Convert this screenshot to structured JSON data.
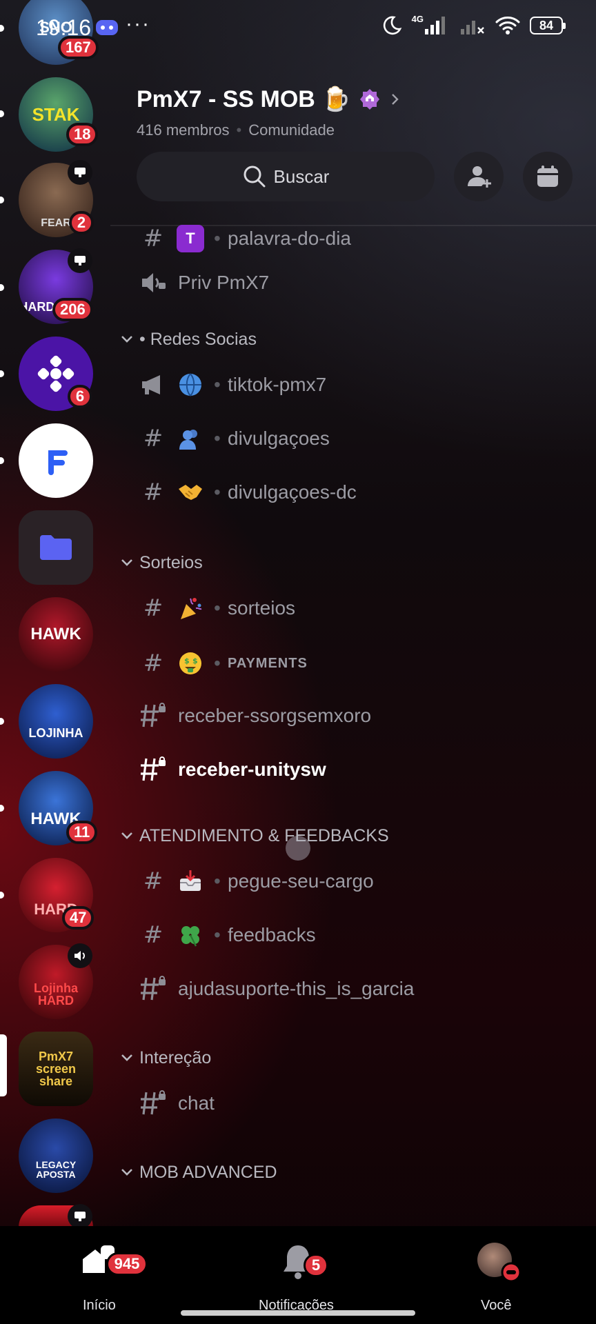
{
  "status_bar": {
    "time": "19:16",
    "network": "4G",
    "battery": "84"
  },
  "server": {
    "name": "PmX7 - SS MOB 🍺",
    "members": "416 membros",
    "type": "Comunidade",
    "search_label": "Buscar"
  },
  "rail": {
    "servers": [
      {
        "name": "server-1",
        "text": "SNO",
        "badge": "167"
      },
      {
        "name": "server-stake",
        "text": "STAK",
        "badge": "18"
      },
      {
        "name": "server-apes",
        "text": "FEAR",
        "badge": "2"
      },
      {
        "name": "server-hard-apostas",
        "text": "HARD APOS",
        "badge": "206"
      },
      {
        "name": "server-purple",
        "text": "",
        "badge": "6"
      },
      {
        "name": "server-f",
        "text": "",
        "badge": ""
      },
      {
        "name": "server-hawk",
        "text": "HAWK",
        "badge": ""
      },
      {
        "name": "server-lojinha-hawk",
        "text": "LOJINHA",
        "badge": ""
      },
      {
        "name": "server-hawk-esports",
        "text": "HAWK",
        "badge": "11"
      },
      {
        "name": "server-hard-apostas-2",
        "text": "HARD",
        "badge": "47"
      },
      {
        "name": "server-lojinha-hard",
        "text": "Lojinha HARD",
        "badge": ""
      },
      {
        "name": "server-pmx7",
        "text": "PmX7 screen share",
        "badge": ""
      },
      {
        "name": "server-legacy",
        "text": "LEGACY APOSTA",
        "badge": ""
      }
    ]
  },
  "channels": {
    "items": [
      {
        "kind": "channel",
        "label": "palavra-do-dia"
      },
      {
        "kind": "voice",
        "label": "Priv PmX7"
      },
      {
        "kind": "category",
        "label": "• Redes Socias"
      },
      {
        "kind": "announce",
        "label": "tiktok-pmx7"
      },
      {
        "kind": "channel",
        "label": "divulgaçoes"
      },
      {
        "kind": "channel",
        "label": "divulgaçoes-dc"
      },
      {
        "kind": "category",
        "label": "Sorteios"
      },
      {
        "kind": "channel",
        "label": "sorteios"
      },
      {
        "kind": "channel",
        "label": "PAYMENTS"
      },
      {
        "kind": "locked",
        "label": "receber-ssorgsemxoro"
      },
      {
        "kind": "locked",
        "label": "receber-unitysw"
      },
      {
        "kind": "category",
        "label": "ATENDIMENTO & FEEDBACKS"
      },
      {
        "kind": "channel",
        "label": "pegue-seu-cargo"
      },
      {
        "kind": "channel",
        "label": "feedbacks"
      },
      {
        "kind": "locked",
        "label": "ajudasuporte-this_is_garcia"
      },
      {
        "kind": "category",
        "label": "Intereção"
      },
      {
        "kind": "locked",
        "label": "chat"
      },
      {
        "kind": "category",
        "label": "MOB ADVANCED"
      }
    ],
    "separator": "•"
  },
  "nav": {
    "home": {
      "label": "Início",
      "badge": "945"
    },
    "notifications": {
      "label": "Notificações",
      "badge": "5"
    },
    "you": {
      "label": "Você"
    }
  },
  "colors": {
    "badge": "#e0323c",
    "boost": "#b069d9",
    "discord": "#5865f2"
  }
}
